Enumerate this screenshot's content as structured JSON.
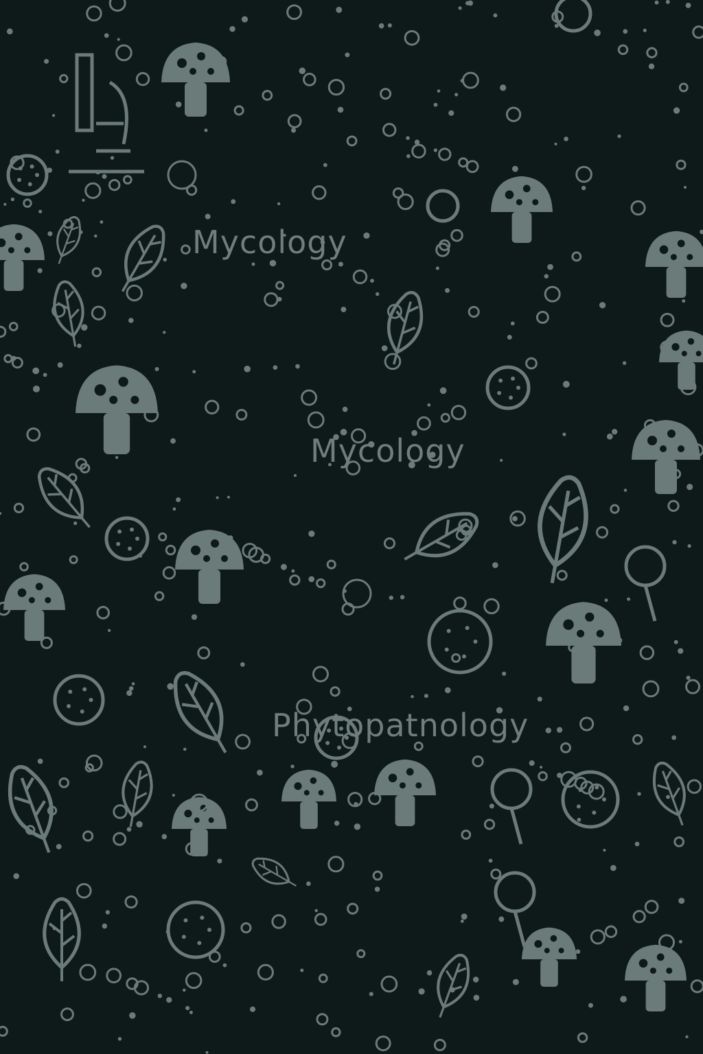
{
  "words": [
    "Mycology",
    "Mycology",
    "Phytopatnology"
  ],
  "colors": {
    "background": "#0e1919",
    "motif": "#6b7b79"
  },
  "motifs": [
    "mushroom-icon",
    "leaf-icon",
    "spore-circle-icon",
    "dot-icon",
    "microscope-icon",
    "magnifier-icon"
  ]
}
